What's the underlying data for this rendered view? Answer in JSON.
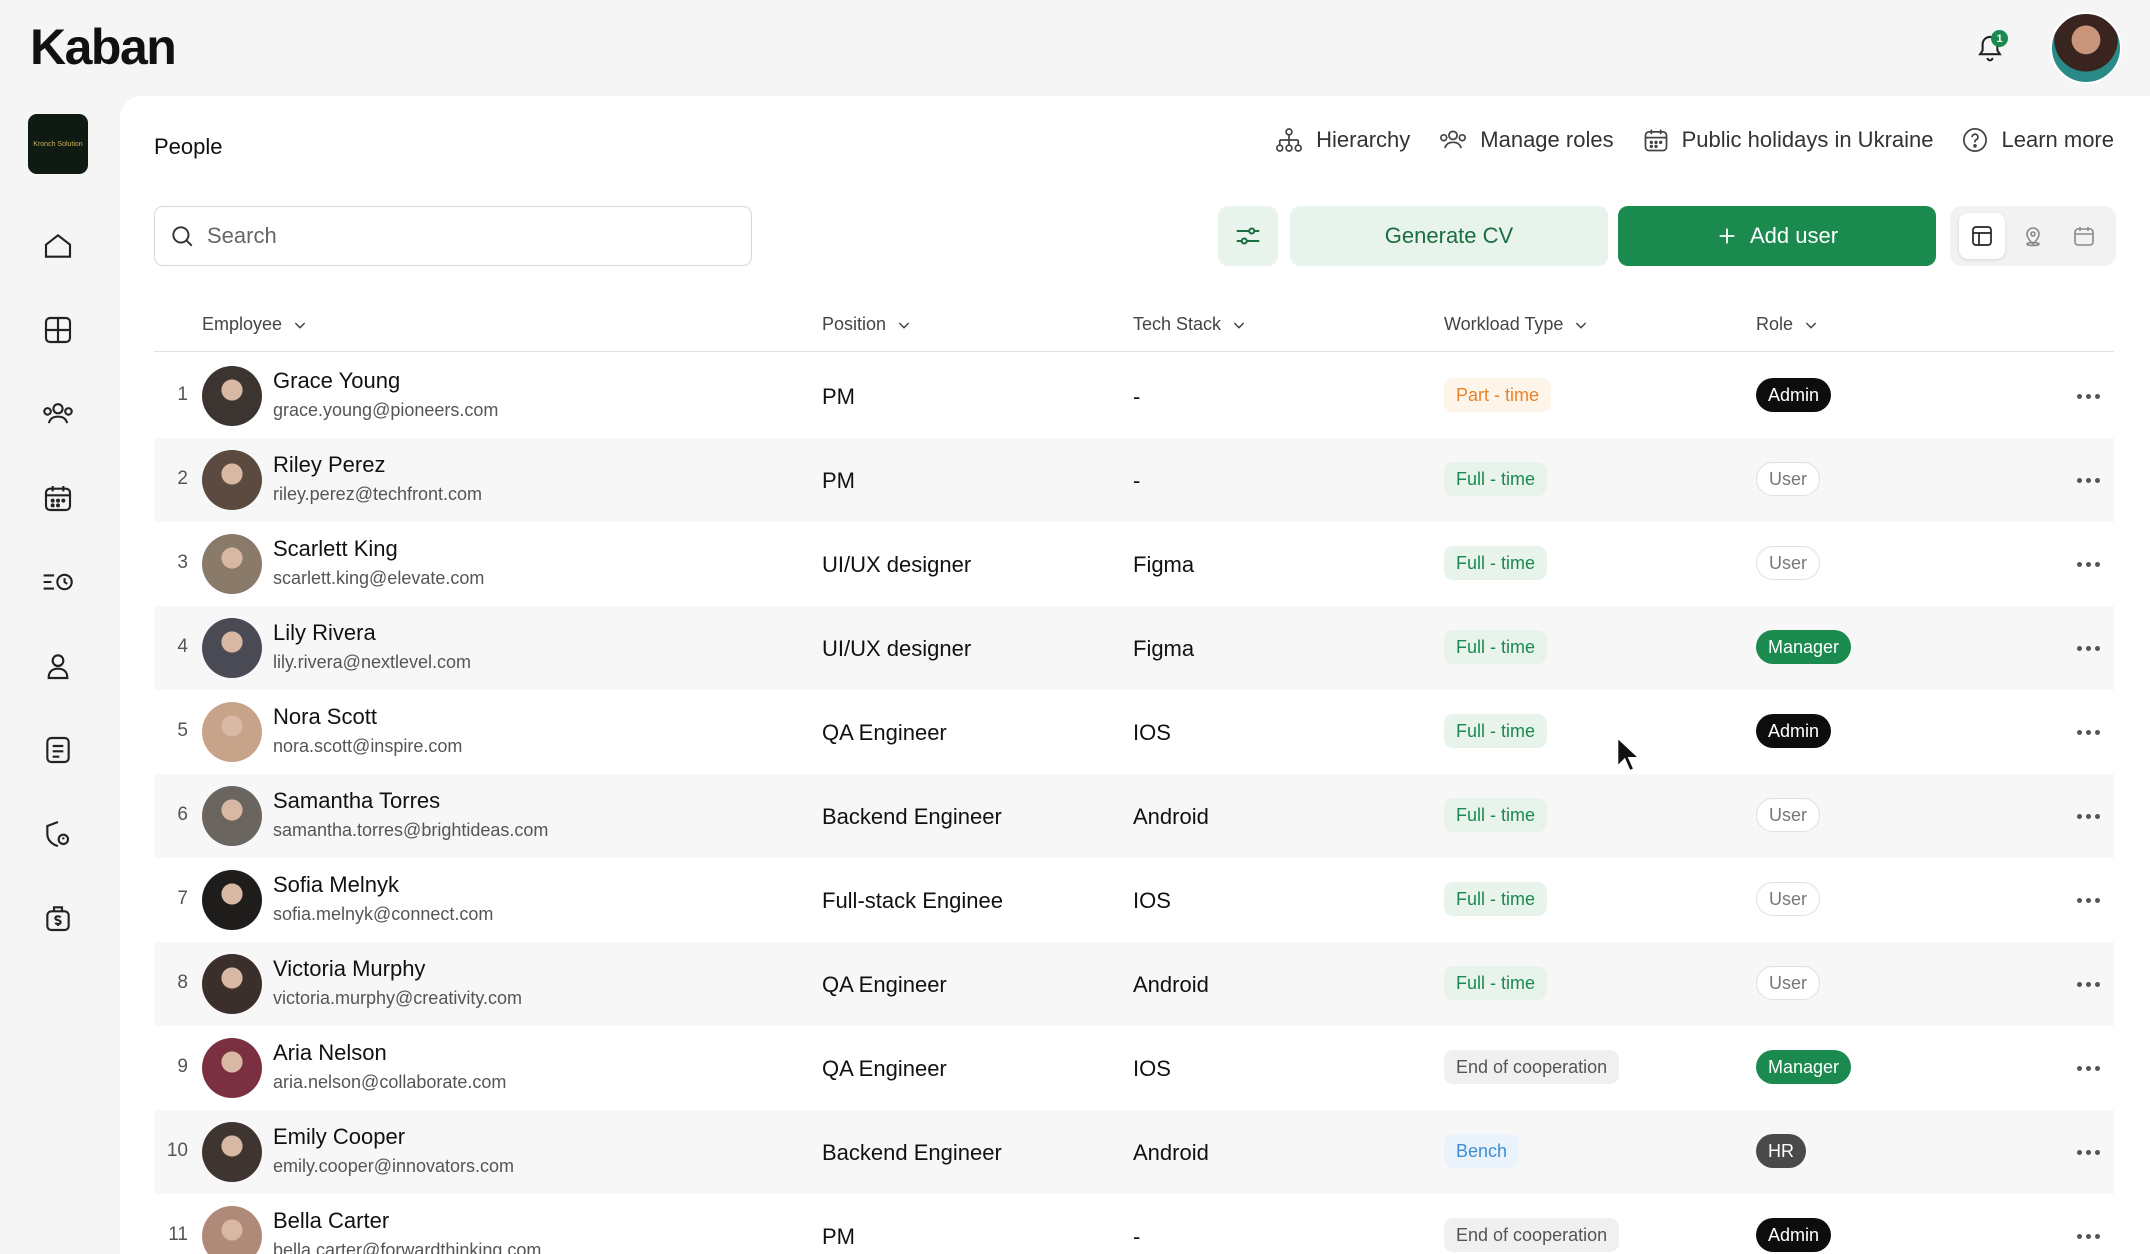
{
  "app": {
    "logo_text": "Kaban",
    "notification_count": "1",
    "workspace_logo_text": "Kronch Solution"
  },
  "colors": {
    "accent": "#1a8a4f",
    "admin": "#0d0d0d",
    "part_time": "#e8832a",
    "bench": "#3c8fd6"
  },
  "sidebar": {
    "items": [
      {
        "name": "home-icon"
      },
      {
        "name": "dashboard-icon"
      },
      {
        "name": "people-icon"
      },
      {
        "name": "calendar-icon"
      },
      {
        "name": "time-tracking-icon"
      },
      {
        "name": "profile-icon"
      },
      {
        "name": "documents-icon"
      },
      {
        "name": "security-icon"
      },
      {
        "name": "finance-icon"
      }
    ]
  },
  "page": {
    "title": "People"
  },
  "header_links": {
    "hierarchy": "Hierarchy",
    "manage_roles": "Manage roles",
    "holidays": "Public holidays in Ukraine",
    "learn_more": "Learn more"
  },
  "toolbar": {
    "search_placeholder": "Search",
    "generate_cv": "Generate CV",
    "add_user": "Add user"
  },
  "table": {
    "columns": {
      "employee": "Employee",
      "position": "Position",
      "tech_stack": "Tech Stack",
      "workload": "Workload Type",
      "role": "Role"
    },
    "rows": [
      {
        "num": "1",
        "name": "Grace Young",
        "email": "grace.young@pioneers.com",
        "position": "PM",
        "stack": "-",
        "workload": "Part - time",
        "workload_kind": "part",
        "role": "Admin",
        "role_kind": "admin",
        "avatar": "#3b3431"
      },
      {
        "num": "2",
        "name": "Riley Perez",
        "email": "riley.perez@techfront.com",
        "position": "PM",
        "stack": "-",
        "workload": "Full - time",
        "workload_kind": "full",
        "role": "User",
        "role_kind": "user",
        "avatar": "#5a4a40"
      },
      {
        "num": "3",
        "name": "Scarlett King",
        "email": "scarlett.king@elevate.com",
        "position": "UI/UX designer",
        "stack": "Figma",
        "workload": "Full - time",
        "workload_kind": "full",
        "role": "User",
        "role_kind": "user",
        "avatar": "#8a7a6a"
      },
      {
        "num": "4",
        "name": "Lily Rivera",
        "email": "lily.rivera@nextlevel.com",
        "position": "UI/UX designer",
        "stack": "Figma",
        "workload": "Full - time",
        "workload_kind": "full",
        "role": "Manager",
        "role_kind": "manager",
        "avatar": "#4a4a55"
      },
      {
        "num": "5",
        "name": "Nora Scott",
        "email": "nora.scott@inspire.com",
        "position": "QA Engineer",
        "stack": "IOS",
        "workload": "Full - time",
        "workload_kind": "full",
        "role": "Admin",
        "role_kind": "admin",
        "avatar": "#c7a38a"
      },
      {
        "num": "6",
        "name": "Samantha Torres",
        "email": "samantha.torres@brightideas.com",
        "position": "Backend Engineer",
        "stack": "Android",
        "workload": "Full - time",
        "workload_kind": "full",
        "role": "User",
        "role_kind": "user",
        "avatar": "#6b6560"
      },
      {
        "num": "7",
        "name": "Sofia Melnyk",
        "email": "sofia.melnyk@connect.com",
        "position": "Full-stack Enginee",
        "stack": "IOS",
        "workload": "Full - time",
        "workload_kind": "full",
        "role": "User",
        "role_kind": "user",
        "avatar": "#1f1c1c"
      },
      {
        "num": "8",
        "name": "Victoria Murphy",
        "email": "victoria.murphy@creativity.com",
        "position": "QA Engineer",
        "stack": "Android",
        "workload": "Full - time",
        "workload_kind": "full",
        "role": "User",
        "role_kind": "user",
        "avatar": "#3a2f2a"
      },
      {
        "num": "9",
        "name": "Aria Nelson",
        "email": "aria.nelson@collaborate.com",
        "position": "QA Engineer",
        "stack": "IOS",
        "workload": "End of cooperation",
        "workload_kind": "end",
        "role": "Manager",
        "role_kind": "manager",
        "avatar": "#7a3040"
      },
      {
        "num": "10",
        "name": "Emily Cooper",
        "email": "emily.cooper@innovators.com",
        "position": "Backend Engineer",
        "stack": "Android",
        "workload": "Bench",
        "workload_kind": "bench",
        "role": "HR",
        "role_kind": "hr",
        "avatar": "#3e3530"
      },
      {
        "num": "11",
        "name": "Bella Carter",
        "email": "bella.carter@forwardthinking.com",
        "position": "PM",
        "stack": "-",
        "workload": "End of cooperation",
        "workload_kind": "end",
        "role": "Admin",
        "role_kind": "admin",
        "avatar": "#b08a78"
      }
    ]
  }
}
